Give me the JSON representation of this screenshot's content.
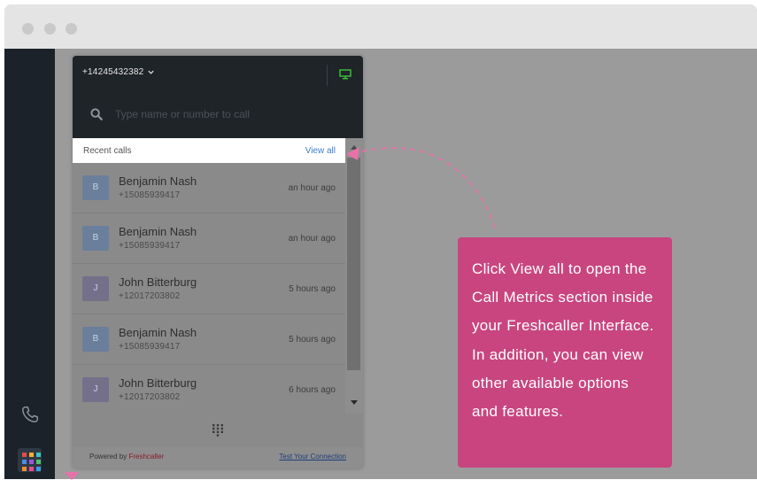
{
  "window": {
    "title": ""
  },
  "widget": {
    "phone_number": "+14245432382",
    "search_placeholder": "Type name or number to call",
    "recent_label": "Recent calls",
    "view_all_label": "View all",
    "calls": [
      {
        "initial": "B",
        "name": "Benjamin Nash",
        "number": "+15085939417",
        "time": "an hour ago",
        "avatar_color": "#6a7f9b"
      },
      {
        "initial": "B",
        "name": "Benjamin Nash",
        "number": "+15085939417",
        "time": "an hour ago",
        "avatar_color": "#6a7f9b"
      },
      {
        "initial": "J",
        "name": "John Bitterburg",
        "number": "+12017203802",
        "time": "5 hours ago",
        "avatar_color": "#75708a"
      },
      {
        "initial": "B",
        "name": "Benjamin Nash",
        "number": "+15085939417",
        "time": "5 hours ago",
        "avatar_color": "#6a7f9b"
      },
      {
        "initial": "J",
        "name": "John Bitterburg",
        "number": "+12017203802",
        "time": "6 hours ago",
        "avatar_color": "#75708a"
      }
    ],
    "powered_by": "Powered by",
    "brand": "Freshcaller",
    "test_connection": "Test Your Connection"
  },
  "tooltip": {
    "text": "Click View all to open the Call Metrics section inside your Freshcaller Interface. In addition, you can view other available options and features."
  },
  "colors": {
    "tooltip_bg": "#c9457f",
    "link": "#3c7fd1",
    "monitor_icon": "#3cc43c",
    "arrow": "#e872a8"
  },
  "icons": [
    "phone-icon",
    "apps-grid-icon",
    "search-icon",
    "monitor-icon",
    "chevron-down-icon",
    "dialpad-icon"
  ]
}
